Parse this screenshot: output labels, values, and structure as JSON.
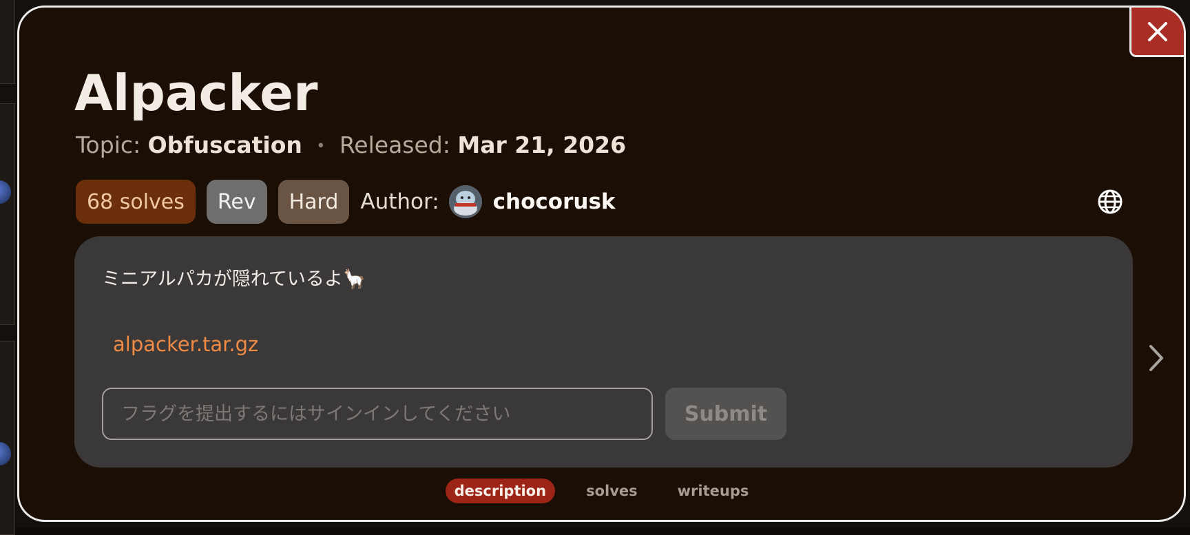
{
  "challenge": {
    "title": "Alpacker",
    "topic_label": "Topic:",
    "topic": "Obfuscation",
    "separator": "•",
    "released_label": "Released:",
    "released": "Mar 21, 2026",
    "solves_badge": "68 solves",
    "category": "Rev",
    "difficulty": "Hard",
    "author_label": "Author:",
    "author_name": "chocorusk",
    "description": "ミニアルパカが隠れているよ🦙",
    "attachment": "alpacker.tar.gz"
  },
  "flag_form": {
    "placeholder": "フラグを提出するにはサインインしてください",
    "value": "",
    "submit_label": "Submit"
  },
  "tabs": [
    {
      "label": "description",
      "active": true
    },
    {
      "label": "solves",
      "active": false
    },
    {
      "label": "writeups",
      "active": false
    }
  ],
  "icons": {
    "close": "close-icon",
    "globe": "globe-icon",
    "next": "chevron-right-icon"
  },
  "colors": {
    "modal_bg": "#1a0e05",
    "panel_bg": "#3a3838",
    "close_bg": "#a82e26",
    "solves_badge_bg": "#6b2f0c",
    "link": "#f08b45",
    "active_tab_bg": "#9c2517"
  }
}
